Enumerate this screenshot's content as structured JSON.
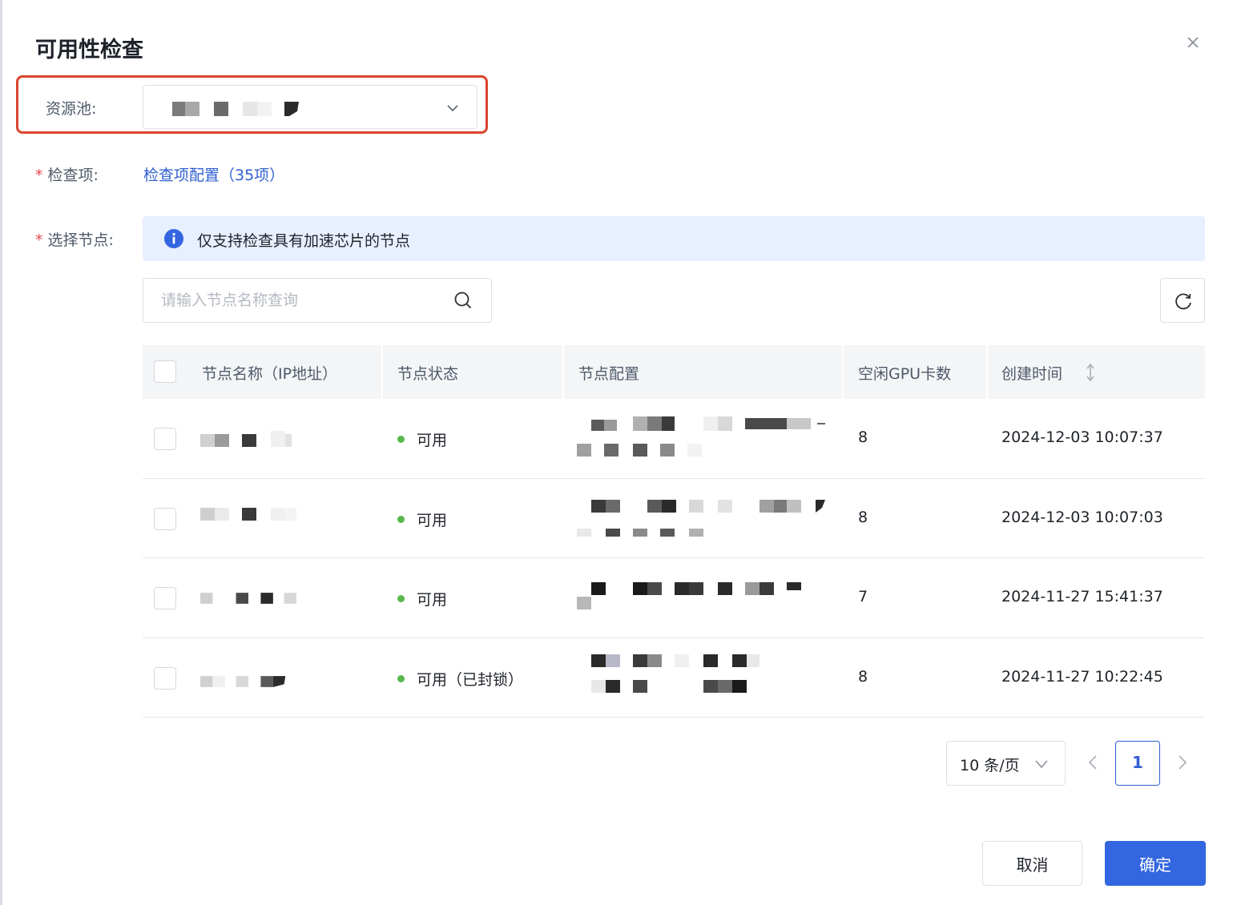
{
  "dialog": {
    "title": "可用性检查",
    "close_icon": "close-icon"
  },
  "form": {
    "pool_label": "资源池:",
    "check_label": "检查项:",
    "check_link": "检查项配置（35项）",
    "node_label": "选择节点:"
  },
  "info_banner": {
    "text": "仅支持检查具有加速芯片的节点",
    "icon": "info-icon",
    "color": "#e8efff"
  },
  "search": {
    "placeholder": "请输入节点名称查询",
    "icon": "search-icon"
  },
  "table": {
    "columns": [
      "节点名称（IP地址）",
      "节点状态",
      "节点配置",
      "空闲GPU卡数",
      "创建时间"
    ],
    "rows": [
      {
        "status": "可用",
        "gpu": "8",
        "created": "2024-12-03 10:07:37"
      },
      {
        "status": "可用",
        "gpu": "8",
        "created": "2024-12-03 10:07:03"
      },
      {
        "status": "可用",
        "gpu": "7",
        "created": "2024-11-27 15:41:37"
      },
      {
        "status": "可用（已封锁）",
        "gpu": "8",
        "created": "2024-11-27 10:22:45"
      }
    ]
  },
  "pagination": {
    "page_size": "10 条/页",
    "current_page": "1"
  },
  "footer": {
    "cancel": "取消",
    "confirm": "确定"
  },
  "colors": {
    "primary": "#3366e0",
    "link": "#2f5fd0",
    "status_ok": "#58b84d",
    "highlight": "#d9452f"
  }
}
